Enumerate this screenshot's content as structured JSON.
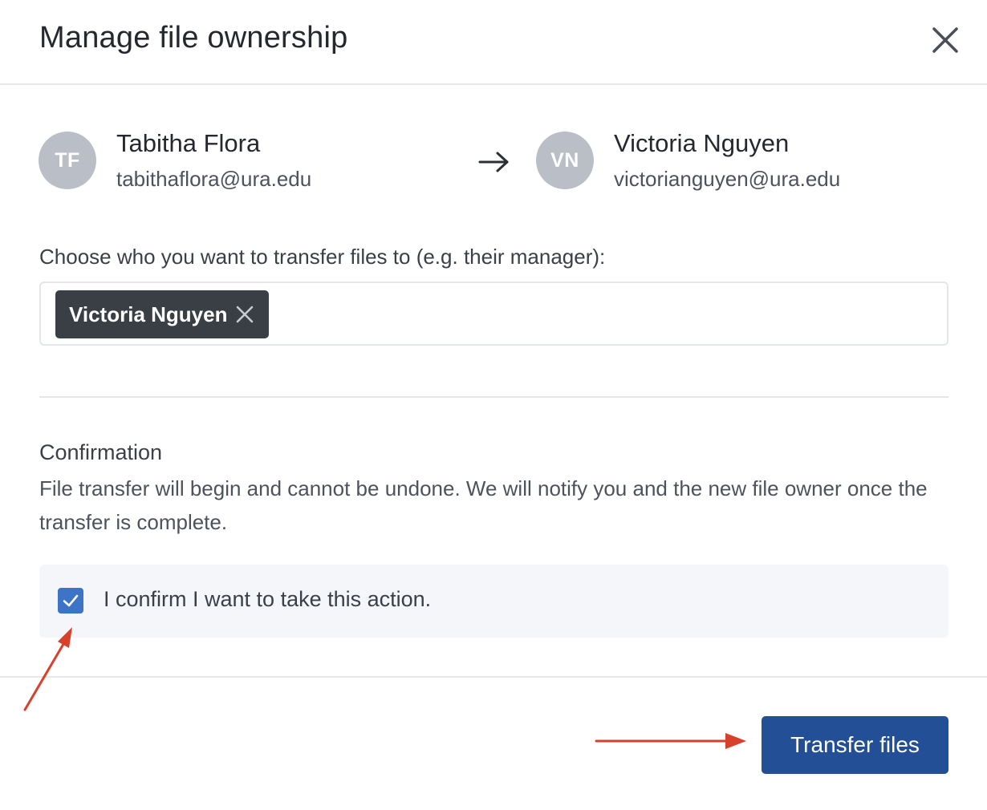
{
  "modal": {
    "title": "Manage file ownership",
    "close_icon": "close-icon"
  },
  "from_user": {
    "initials": "TF",
    "name": "Tabitha Flora",
    "email": "tabithaflora@ura.edu"
  },
  "to_user": {
    "initials": "VN",
    "name": "Victoria Nguyen",
    "email": "victorianguyen@ura.edu"
  },
  "transfer_arrow_icon": "arrow-right-icon",
  "recipient_field": {
    "label": "Choose who you want to transfer files to (e.g. their manager):",
    "chips": [
      {
        "label": "Victoria Nguyen",
        "remove_icon": "close-icon"
      }
    ]
  },
  "confirmation": {
    "heading": "Confirmation",
    "text": "File transfer will begin and cannot be undone. We will notify you and the new file owner once the transfer is complete.",
    "checkbox_label": "I confirm I want to take this action.",
    "checked": true
  },
  "footer": {
    "transfer_button_label": "Transfer files"
  },
  "colors": {
    "primary_button": "#224f95",
    "checkbox": "#3d74c8",
    "chip": "#3a3f45",
    "avatar": "#b9bec7",
    "annotation_arrow": "#d9402b"
  }
}
